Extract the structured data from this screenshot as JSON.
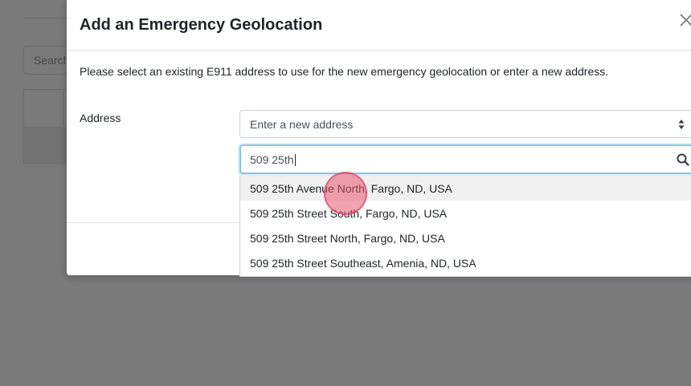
{
  "background": {
    "search_placeholder": "Search"
  },
  "modal": {
    "title": "Add an Emergency Geolocation",
    "close_icon": "close-icon",
    "intro": "Please select an existing E911 address to use for the new emergency geolocation or enter a new address.",
    "address_label": "Address",
    "address_select": {
      "selected": "Enter a new address"
    },
    "search": {
      "value": "509 25th",
      "icon": "search-icon"
    },
    "suggestions": [
      {
        "label": "509 25th Avenue North, Fargo, ND, USA",
        "highlighted": true
      },
      {
        "label": "509 25th Street South, Fargo, ND, USA",
        "highlighted": false
      },
      {
        "label": "509 25th Street North, Fargo, ND, USA",
        "highlighted": false
      },
      {
        "label": "509 25th Street Southeast, Amenia, ND, USA",
        "highlighted": false
      }
    ]
  },
  "colors": {
    "overlay": "#7a7a7a",
    "focus_border": "#86c5e8",
    "highlight": "#f1f1f1",
    "click_marker": "#e9556e"
  }
}
